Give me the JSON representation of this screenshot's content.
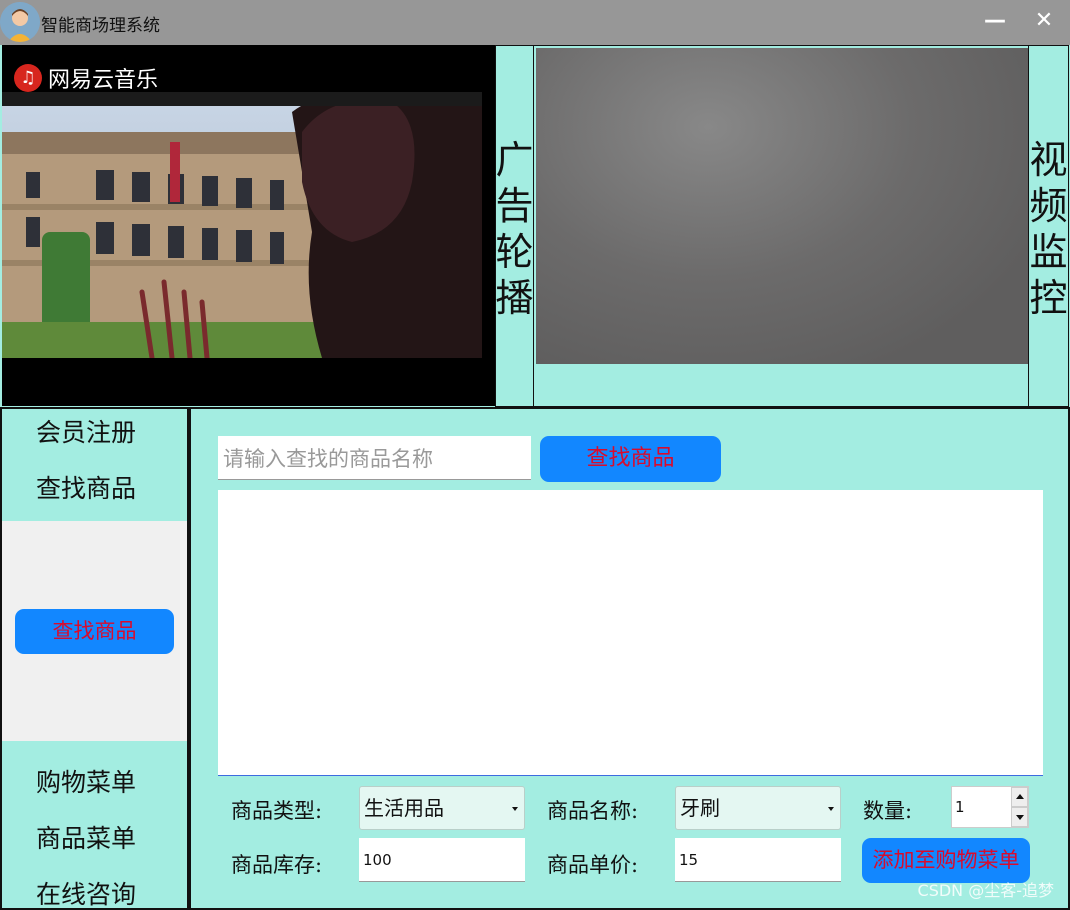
{
  "window": {
    "title": "智能商场理系统",
    "minimize": "—",
    "close": "✕"
  },
  "ad": {
    "logo_text": "网易云音乐",
    "label": [
      "广",
      "告",
      "轮",
      "播"
    ]
  },
  "camera": {
    "label": [
      "视",
      "频",
      "监",
      "控"
    ]
  },
  "sidebar": {
    "items": [
      "会员注册",
      "查找商品",
      "购物菜单",
      "商品菜单",
      "在线咨询"
    ],
    "active_button": "查找商品"
  },
  "search": {
    "placeholder": "请输入查找的商品名称",
    "button": "查找商品"
  },
  "form": {
    "type_label": "商品类型:",
    "type_value": "生活用品",
    "name_label": "商品名称:",
    "name_value": "牙刷",
    "qty_label": "数量:",
    "qty_value": "1",
    "stock_label": "商品库存:",
    "stock_value": "100",
    "price_label": "商品单价:",
    "price_value": "15",
    "add_button": "添加至购物菜单"
  },
  "watermark": "CSDN @尘客-追梦",
  "colors": {
    "panel": "#a3ede1",
    "button": "#1287ff",
    "button_text": "#d80c2e",
    "titlebar": "#979797"
  }
}
